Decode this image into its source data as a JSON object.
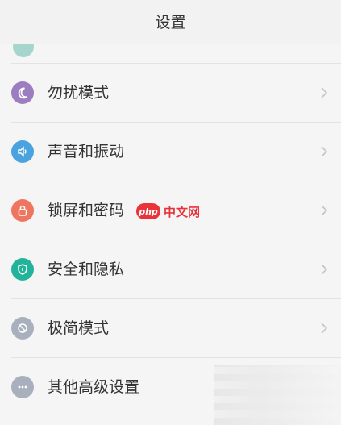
{
  "header": {
    "title": "设置"
  },
  "settings": {
    "items": [
      {
        "label": "勿扰模式",
        "icon": "moon-icon",
        "color": "#9b7dc0"
      },
      {
        "label": "声音和振动",
        "icon": "speaker-icon",
        "color": "#4aa3df"
      },
      {
        "label": "锁屏和密码",
        "icon": "lock-icon",
        "color": "#ee7660"
      },
      {
        "label": "安全和隐私",
        "icon": "shield-icon",
        "color": "#22b39a"
      },
      {
        "label": "极简模式",
        "icon": "minimal-mode-icon",
        "color": "#a9b0bd"
      },
      {
        "label": "其他高级设置",
        "icon": "more-dots-icon",
        "color": "#a9b0bd"
      }
    ]
  },
  "watermark": {
    "logo": "php",
    "text": "中文网"
  }
}
